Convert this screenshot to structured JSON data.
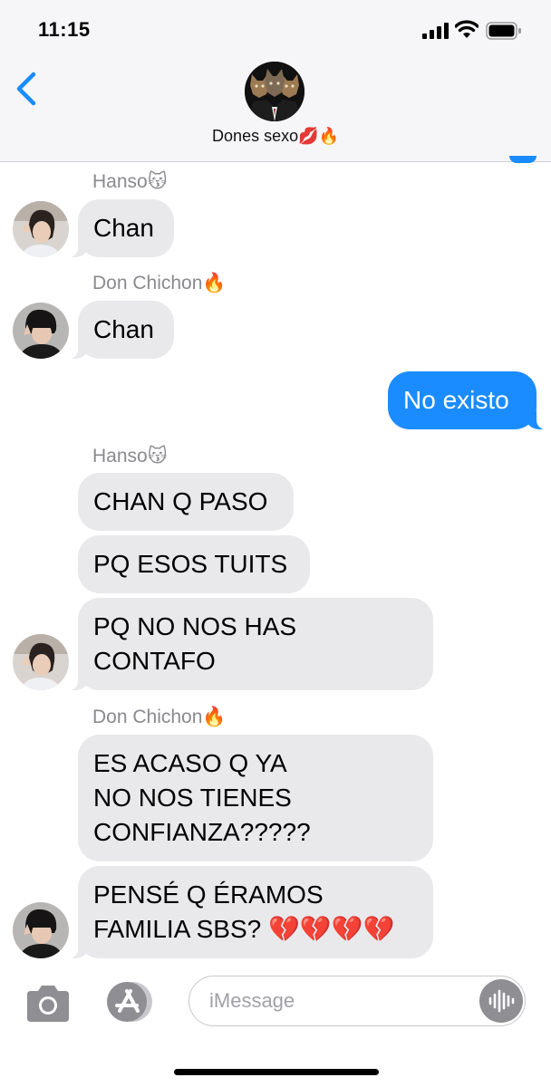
{
  "status_bar": {
    "time": "11:15"
  },
  "header": {
    "group_name": "Dones sexo💋🔥"
  },
  "messages": [
    {
      "sender": "Hanso😽",
      "text": [
        "Chan"
      ]
    },
    {
      "sender": "Don Chichon🔥",
      "text": [
        "Chan"
      ]
    },
    {
      "outgoing": true,
      "text": [
        "No existo"
      ]
    },
    {
      "sender": "Hanso😽",
      "text": [
        "CHAN Q PASO"
      ]
    },
    {
      "text": [
        "PQ ESOS TUITS"
      ]
    },
    {
      "text": [
        "PQ NO NOS HAS",
        "CONTAFO"
      ]
    },
    {
      "sender": "Don Chichon🔥",
      "text": [
        "ES ACASO Q YA",
        "NO NOS TIENES",
        "CONFIANZA?????"
      ]
    },
    {
      "text": [
        "PENSÉ Q ÉRAMOS",
        "FAMILIA SBS? 💔💔💔💔"
      ]
    }
  ],
  "composer": {
    "placeholder": "iMessage"
  },
  "icons": {
    "back": "chevron-left-icon",
    "camera": "camera-icon",
    "apps": "app-store-icon",
    "audio": "audio-waveform-icon"
  },
  "colors": {
    "outgoing": "#1a8cff",
    "incoming": "#e9e9eb",
    "accent": "#1a8cff"
  }
}
